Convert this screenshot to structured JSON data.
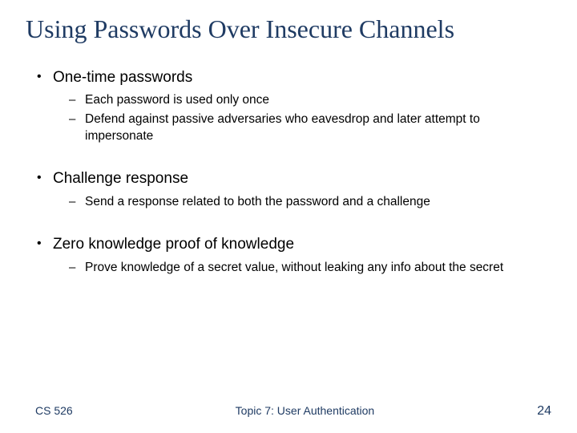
{
  "title": "Using Passwords Over Insecure Channels",
  "bullets": [
    {
      "text": "One-time passwords",
      "subs": [
        "Each password is used only once",
        "Defend against passive adversaries who eavesdrop and later attempt to impersonate"
      ]
    },
    {
      "text": "Challenge response",
      "subs": [
        "Send a response related to both the password and a challenge"
      ]
    },
    {
      "text": "Zero knowledge proof of knowledge",
      "subs": [
        "Prove knowledge of a secret value, without leaking any info about the secret"
      ]
    }
  ],
  "footer": {
    "left": "CS 526",
    "center": "Topic 7: User Authentication",
    "right": "24"
  }
}
